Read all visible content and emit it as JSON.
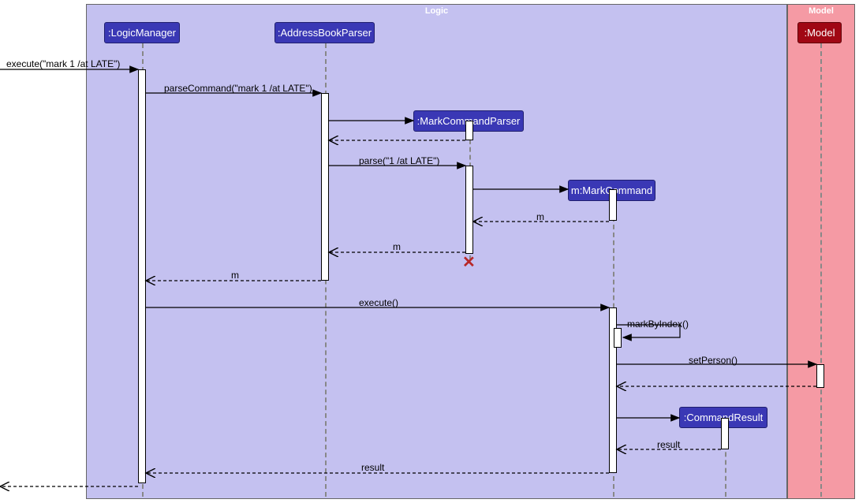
{
  "regions": {
    "logic": {
      "title": "Logic"
    },
    "model": {
      "title": "Model"
    }
  },
  "participants": {
    "logicManager": ":LogicManager",
    "addressBookParser": ":AddressBookParser",
    "markCommandParser": ":MarkCommandParser",
    "markCommand": "m:MarkCommand",
    "commandResult": ":CommandResult",
    "model": ":Model"
  },
  "messages": {
    "execute_in": "execute(\"mark 1 /at LATE\")",
    "parseCommand": "parseCommand(\"mark 1 /at LATE\")",
    "parse": "parse(\"1 /at LATE\")",
    "m_return1": "m",
    "m_return2": "m",
    "m_return3": "m",
    "execute": "execute()",
    "markByIndex": "markByIndex()",
    "setPerson": "setPerson()",
    "result_return1": "result",
    "result_return2": "result"
  }
}
